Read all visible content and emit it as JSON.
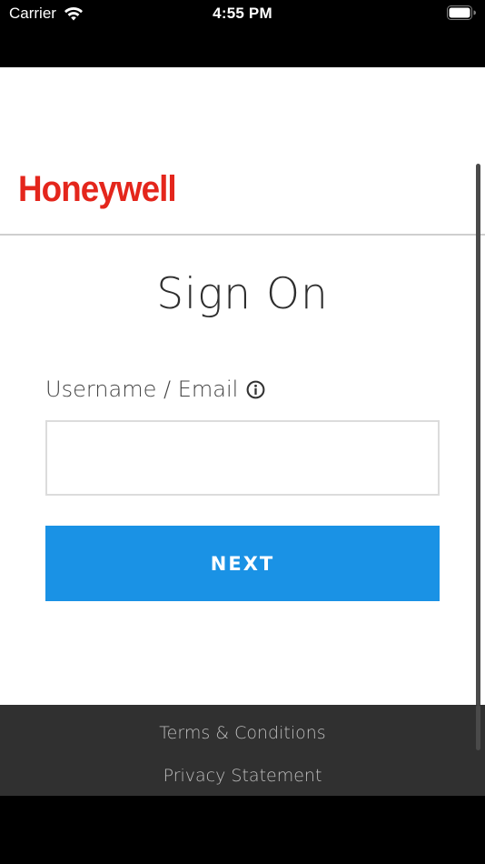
{
  "status_bar": {
    "carrier": "Carrier",
    "time": "4:55 PM",
    "icons": [
      "wifi-icon",
      "battery-icon"
    ]
  },
  "brand": {
    "logo_text": "Honeywell",
    "logo_color": "#e4261c"
  },
  "signin": {
    "title": "Sign On",
    "username_label": "Username / Email",
    "username_value": "",
    "info_icon": "info-icon",
    "next_label": "NEXT",
    "accent_color": "#1a92e5"
  },
  "footer": {
    "terms_label": "Terms & Conditions",
    "privacy_label": "Privacy Statement"
  }
}
